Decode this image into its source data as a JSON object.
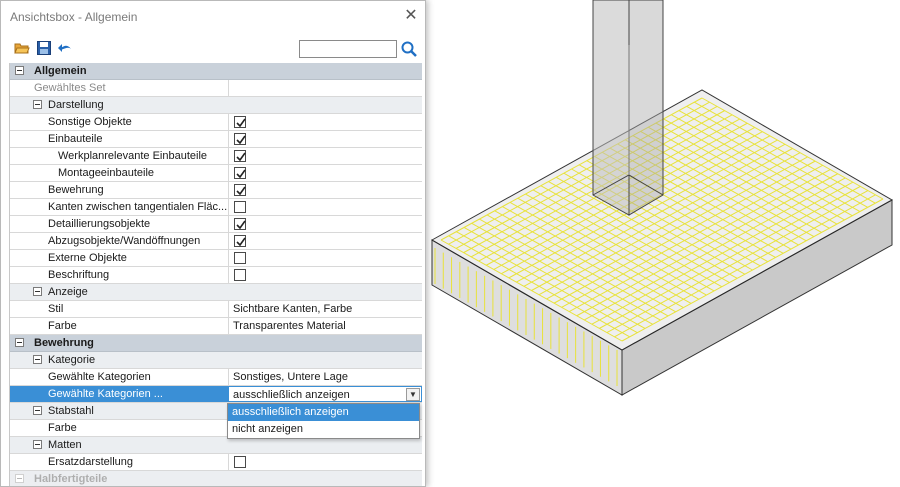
{
  "window": {
    "title": "Ansichtsbox - Allgemein",
    "close_glyph": "✕"
  },
  "toolbar": {
    "search_value": "",
    "icons": [
      "open-folder-icon",
      "save-icon",
      "undo-icon",
      "search-icon"
    ]
  },
  "tree": {
    "allgemein": "Allgemein",
    "gewaehltes_set": "Gewähltes Set",
    "darstellung": "Darstellung",
    "sonstige_objekte": "Sonstige Objekte",
    "einbauteile": "Einbauteile",
    "werkplan": "Werkplanrelevante Einbauteile",
    "montage": "Montageeinbauteile",
    "bewehrung_item": "Bewehrung",
    "kanten": "Kanten zwischen tangentialen Fläc...",
    "detaillierung": "Detaillierungsobjekte",
    "abzug": "Abzugsobjekte/Wandöffnungen",
    "externe": "Externe Objekte",
    "beschriftung": "Beschriftung",
    "anzeige": "Anzeige",
    "stil": "Stil",
    "stil_value": "Sichtbare Kanten, Farbe",
    "farbe": "Farbe",
    "farbe_value": "Transparentes Material",
    "bewehrung_group": "Bewehrung",
    "kategorie": "Kategorie",
    "gew_kat": "Gewählte Kategorien",
    "gew_kat_value": "Sonstiges, Untere Lage",
    "gew_kat2": "Gewählte Kategorien ...",
    "gew_kat2_value": "ausschließlich anzeigen",
    "stabstahl": "Stabstahl",
    "farbe2": "Farbe",
    "matten": "Matten",
    "ersatz": "Ersatzdarstellung",
    "halbfertigteile": "Halbfertigteile"
  },
  "checks": {
    "sonstige_objekte": true,
    "einbauteile": true,
    "werkplan": true,
    "montage": true,
    "bewehrung": true,
    "kanten": false,
    "detaillierung": true,
    "abzug": true,
    "externe": false,
    "beschriftung": false,
    "ersatz": false
  },
  "dropdown": {
    "options": [
      "ausschließlich anzeigen",
      "nicht anzeigen"
    ],
    "selected": "ausschließlich anzeigen"
  },
  "colors": {
    "group_header": "#c9d1da",
    "selection": "#3a8fd6",
    "rebar": "#e8e23a",
    "slab_fill": "#d9d9d9"
  }
}
